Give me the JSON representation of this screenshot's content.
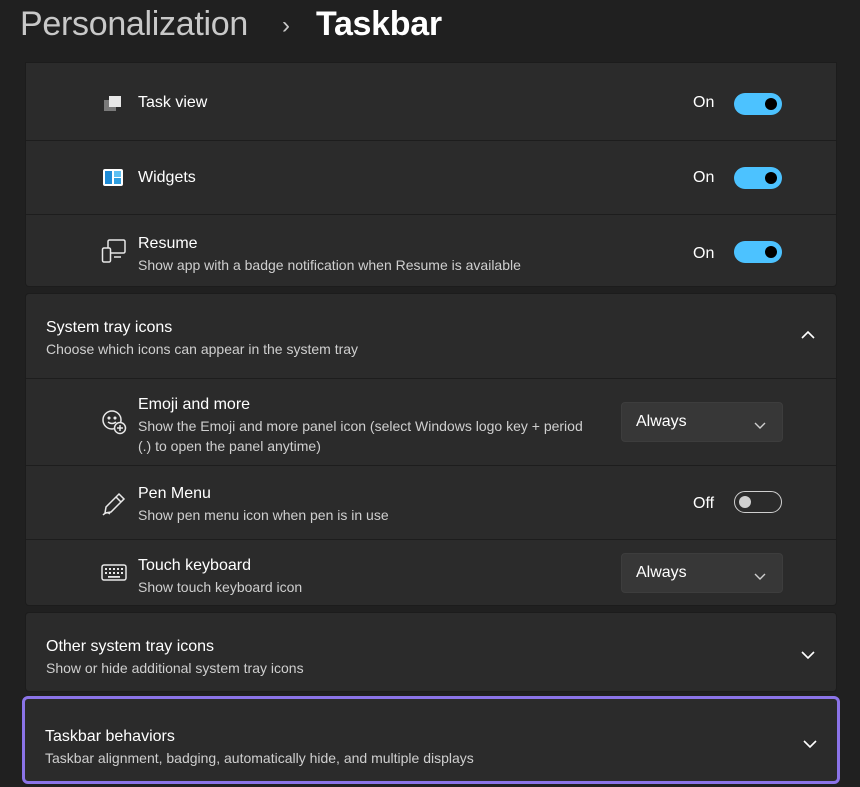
{
  "header": {
    "parent": "Personalization",
    "separator": "›",
    "current": "Taskbar"
  },
  "taskbar_items": [
    {
      "label": "Task view",
      "description": "",
      "state_label": "On",
      "on": true,
      "icon": "task-view-icon"
    },
    {
      "label": "Widgets",
      "description": "",
      "state_label": "On",
      "on": true,
      "icon": "widgets-icon"
    },
    {
      "label": "Resume",
      "description": "Show app with a badge notification when Resume is available",
      "state_label": "On",
      "on": true,
      "icon": "resume-icon"
    }
  ],
  "system_tray": {
    "title": "System tray icons",
    "description": "Choose which icons can appear in the system tray",
    "expanded": true,
    "items": [
      {
        "label": "Emoji and more",
        "description": "Show the Emoji and more panel icon (select Windows logo key + period (.) to open the panel anytime)",
        "control": "dropdown",
        "value": "Always",
        "icon": "emoji-icon"
      },
      {
        "label": "Pen Menu",
        "description": "Show pen menu icon when pen is in use",
        "control": "toggle",
        "state_label": "Off",
        "on": false,
        "icon": "pen-icon"
      },
      {
        "label": "Touch keyboard",
        "description": "Show touch keyboard icon",
        "control": "dropdown",
        "value": "Always",
        "icon": "keyboard-icon"
      }
    ]
  },
  "other_tray": {
    "title": "Other system tray icons",
    "description": "Show or hide additional system tray icons",
    "expanded": false
  },
  "behaviors": {
    "title": "Taskbar behaviors",
    "description": "Taskbar alignment, badging, automatically hide, and multiple displays",
    "expanded": false,
    "highlighted": true
  },
  "colors": {
    "background": "#202020",
    "card": "#2b2b2b",
    "accent": "#4cc2ff",
    "focus_outline": "#8b74e8"
  }
}
